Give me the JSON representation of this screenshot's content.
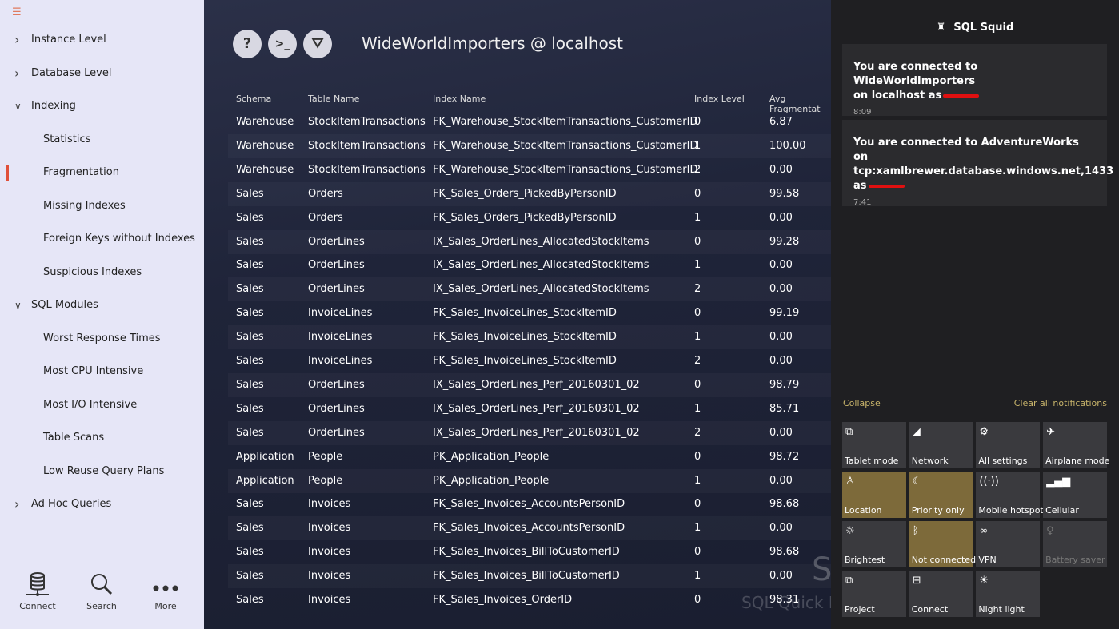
{
  "sidebar": {
    "menu_icon": "hamburger-icon",
    "items": [
      {
        "label": "Instance Level",
        "level": 0,
        "expandable": true,
        "expanded": false
      },
      {
        "label": "Database Level",
        "level": 0,
        "expandable": true,
        "expanded": false
      },
      {
        "label": "Indexing",
        "level": 0,
        "expandable": true,
        "expanded": true
      },
      {
        "label": "Statistics",
        "level": 1
      },
      {
        "label": "Fragmentation",
        "level": 1,
        "selected": true
      },
      {
        "label": "Missing Indexes",
        "level": 1
      },
      {
        "label": "Foreign Keys without Indexes",
        "level": 1
      },
      {
        "label": "Suspicious Indexes",
        "level": 1
      },
      {
        "label": "SQL Modules",
        "level": 0,
        "expandable": true,
        "expanded": true
      },
      {
        "label": "Worst Response Times",
        "level": 1
      },
      {
        "label": "Most CPU Intensive",
        "level": 1
      },
      {
        "label": "Most I/O Intensive",
        "level": 1
      },
      {
        "label": "Table Scans",
        "level": 1
      },
      {
        "label": "Low Reuse Query Plans",
        "level": 1
      },
      {
        "label": "Ad Hoc Queries",
        "level": 0,
        "expandable": true,
        "expanded": false
      }
    ],
    "bottom": [
      {
        "label": "Connect",
        "icon": "database-icon"
      },
      {
        "label": "Search",
        "icon": "search-icon"
      },
      {
        "label": "More",
        "icon": "more-icon"
      }
    ]
  },
  "main": {
    "title": "WideWorldImporters @ localhost",
    "toolbar": [
      {
        "icon": "help-icon",
        "glyph": "?"
      },
      {
        "icon": "terminal-icon",
        "glyph": ">_"
      },
      {
        "icon": "filter-icon",
        "glyph": "⛛"
      }
    ],
    "columns": [
      "Schema",
      "Table Name",
      "Index Name",
      "Index Level",
      "Avg Fragmentat"
    ],
    "rows": [
      [
        "Warehouse",
        "StockItemTransactions",
        "FK_Warehouse_StockItemTransactions_CustomerID",
        "0",
        "6.87"
      ],
      [
        "Warehouse",
        "StockItemTransactions",
        "FK_Warehouse_StockItemTransactions_CustomerID",
        "1",
        "100.00"
      ],
      [
        "Warehouse",
        "StockItemTransactions",
        "FK_Warehouse_StockItemTransactions_CustomerID",
        "2",
        "0.00"
      ],
      [
        "Sales",
        "Orders",
        "FK_Sales_Orders_PickedByPersonID",
        "0",
        "99.58"
      ],
      [
        "Sales",
        "Orders",
        "FK_Sales_Orders_PickedByPersonID",
        "1",
        "0.00"
      ],
      [
        "Sales",
        "OrderLines",
        "IX_Sales_OrderLines_AllocatedStockItems",
        "0",
        "99.28"
      ],
      [
        "Sales",
        "OrderLines",
        "IX_Sales_OrderLines_AllocatedStockItems",
        "1",
        "0.00"
      ],
      [
        "Sales",
        "OrderLines",
        "IX_Sales_OrderLines_AllocatedStockItems",
        "2",
        "0.00"
      ],
      [
        "Sales",
        "InvoiceLines",
        "FK_Sales_InvoiceLines_StockItemID",
        "0",
        "99.19"
      ],
      [
        "Sales",
        "InvoiceLines",
        "FK_Sales_InvoiceLines_StockItemID",
        "1",
        "0.00"
      ],
      [
        "Sales",
        "InvoiceLines",
        "FK_Sales_InvoiceLines_StockItemID",
        "2",
        "0.00"
      ],
      [
        "Sales",
        "OrderLines",
        "IX_Sales_OrderLines_Perf_20160301_02",
        "0",
        "98.79"
      ],
      [
        "Sales",
        "OrderLines",
        "IX_Sales_OrderLines_Perf_20160301_02",
        "1",
        "85.71"
      ],
      [
        "Sales",
        "OrderLines",
        "IX_Sales_OrderLines_Perf_20160301_02",
        "2",
        "0.00"
      ],
      [
        "Application",
        "People",
        "PK_Application_People",
        "0",
        "98.72"
      ],
      [
        "Application",
        "People",
        "PK_Application_People",
        "1",
        "0.00"
      ],
      [
        "Sales",
        "Invoices",
        "FK_Sales_Invoices_AccountsPersonID",
        "0",
        "98.68"
      ],
      [
        "Sales",
        "Invoices",
        "FK_Sales_Invoices_AccountsPersonID",
        "1",
        "0.00"
      ],
      [
        "Sales",
        "Invoices",
        "FK_Sales_Invoices_BillToCustomerID",
        "0",
        "98.68"
      ],
      [
        "Sales",
        "Invoices",
        "FK_Sales_Invoices_BillToCustomerID",
        "1",
        "0.00"
      ],
      [
        "Sales",
        "Invoices",
        "FK_Sales_Invoices_OrderID",
        "0",
        "98.31"
      ]
    ],
    "watermark": {
      "big": "S",
      "small": "SQL Quick D"
    }
  },
  "action_center": {
    "app_name": "SQL Squid",
    "app_icon": "squid-icon",
    "notifications": [
      {
        "line1": "You are connected to WideWorldImporters",
        "line2": "on localhost as",
        "time": "8:09"
      },
      {
        "line1": "You are connected to AdventureWorks on",
        "line2": "tcp:xamlbrewer.database.windows.net,1433",
        "line3": "as",
        "time": "7:41"
      }
    ],
    "collapse": "Collapse",
    "clear_all": "Clear all notifications",
    "accent": "#7d6a3a",
    "tiles": [
      {
        "label": "Tablet mode",
        "icon": "tablet-mode-icon",
        "glyph": "⧉",
        "on": false
      },
      {
        "label": "Network",
        "icon": "network-icon",
        "glyph": "◢",
        "on": false
      },
      {
        "label": "All settings",
        "icon": "gear-icon",
        "glyph": "⚙",
        "on": false
      },
      {
        "label": "Airplane mode",
        "icon": "airplane-icon",
        "glyph": "✈",
        "on": false
      },
      {
        "label": "Location",
        "icon": "location-icon",
        "glyph": "♙",
        "on": true
      },
      {
        "label": "Priority only",
        "icon": "moon-icon",
        "glyph": "☾",
        "on": true
      },
      {
        "label": "Mobile hotspot",
        "icon": "hotspot-icon",
        "glyph": "((·))",
        "on": false
      },
      {
        "label": "Cellular",
        "icon": "cellular-icon",
        "glyph": "▂▄▆",
        "on": false
      },
      {
        "label": "Brightest",
        "icon": "brightness-icon",
        "glyph": "☼",
        "on": false
      },
      {
        "label": "Not connected",
        "icon": "bluetooth-icon",
        "glyph": "ᛒ",
        "on": true
      },
      {
        "label": "VPN",
        "icon": "vpn-icon",
        "glyph": "∞",
        "on": false
      },
      {
        "label": "Battery saver",
        "icon": "battery-saver-icon",
        "glyph": "♀",
        "on": false,
        "disabled": true
      },
      {
        "label": "Project",
        "icon": "project-icon",
        "glyph": "⧉",
        "on": false
      },
      {
        "label": "Connect",
        "icon": "connect-icon",
        "glyph": "⊟",
        "on": false
      },
      {
        "label": "Night light",
        "icon": "night-light-icon",
        "glyph": "☀",
        "on": false
      }
    ]
  }
}
